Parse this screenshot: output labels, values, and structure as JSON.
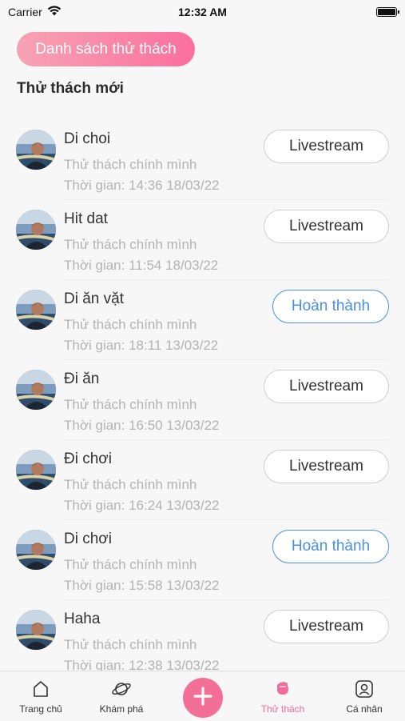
{
  "status_bar": {
    "carrier": "Carrier",
    "time": "12:32 AM"
  },
  "header": {
    "list_button": "Danh sách thử thách",
    "section_title": "Thử thách mới"
  },
  "challenges": [
    {
      "title": "Di choi",
      "subtitle": "Thử thách chính mình",
      "time": "Thời gian: 14:36 18/03/22",
      "action": "Livestream",
      "action_type": "live"
    },
    {
      "title": "Hit dat",
      "subtitle": "Thử thách chính mình",
      "time": "Thời gian: 11:54 18/03/22",
      "action": "Livestream",
      "action_type": "live"
    },
    {
      "title": "Di ăn vặt",
      "subtitle": "Thử thách chính mình",
      "time": "Thời gian: 18:11 13/03/22",
      "action": "Hoàn thành",
      "action_type": "done"
    },
    {
      "title": "Đi ăn",
      "subtitle": "Thử thách chính mình",
      "time": "Thời gian: 16:50 13/03/22",
      "action": "Livestream",
      "action_type": "live"
    },
    {
      "title": "Đi chơi",
      "subtitle": "Thử thách chính mình",
      "time": "Thời gian: 16:24 13/03/22",
      "action": "Livestream",
      "action_type": "live"
    },
    {
      "title": "Di chơi",
      "subtitle": "Thử thách chính mình",
      "time": "Thời gian: 15:58 13/03/22",
      "action": "Hoàn thành",
      "action_type": "done"
    },
    {
      "title": "Haha",
      "subtitle": "Thử thách chính mình",
      "time": "Thời gian: 12:38 13/03/22",
      "action": "Livestream",
      "action_type": "live"
    }
  ],
  "tabbar": {
    "items": [
      {
        "label": "Trang chủ",
        "icon": "home-icon"
      },
      {
        "label": "Khám phá",
        "icon": "planet-icon"
      },
      {
        "label": "",
        "icon": "plus-icon"
      },
      {
        "label": "Thử thách",
        "icon": "fist-icon",
        "active": true
      },
      {
        "label": "Cá nhân",
        "icon": "profile-icon"
      }
    ]
  },
  "colors": {
    "accent": "#f36b9c",
    "done_blue": "#4a90e2",
    "muted": "#b3b3b3"
  }
}
